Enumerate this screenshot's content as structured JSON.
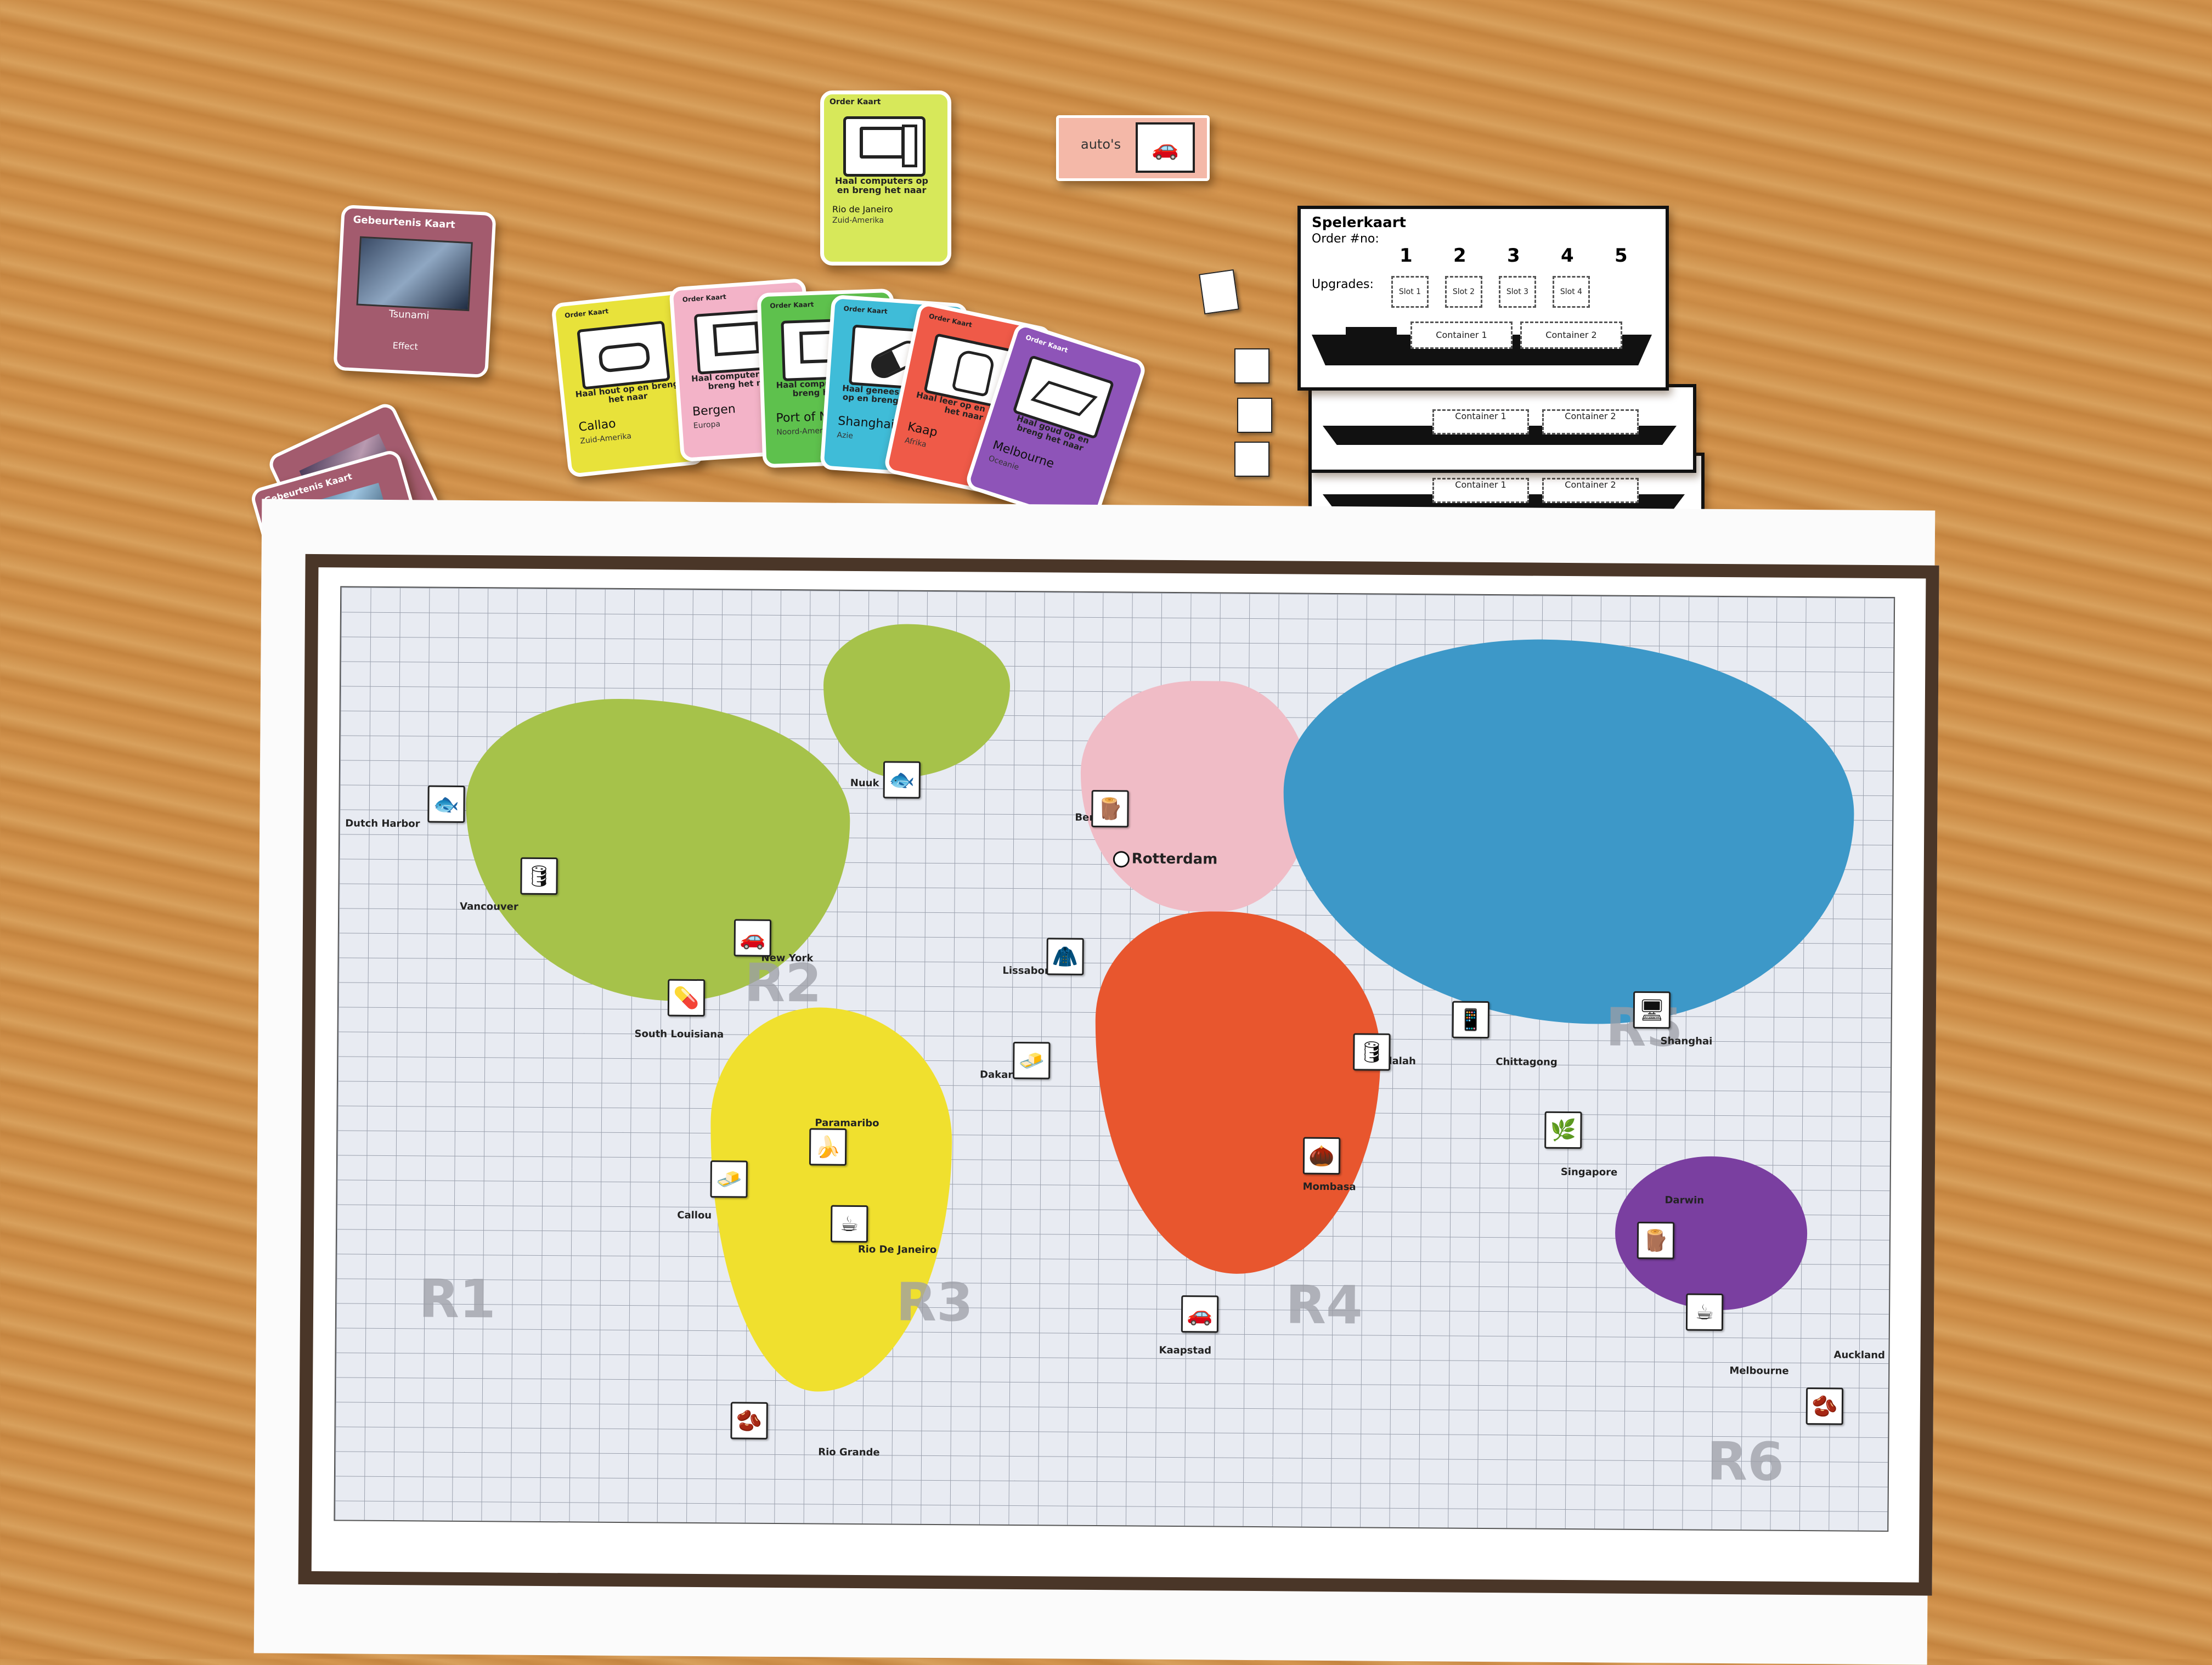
{
  "event_deck": {
    "header": "Gebeurtenis Kaart",
    "title": "Tsunami",
    "effect_label": "Effect"
  },
  "order_deck_top": {
    "header": "Order Kaart",
    "text": "Haal computers op en breng het naar",
    "place": "Rio de Janeiro",
    "region": "Zuid-Amerika",
    "icon": "computer-icon",
    "color": "#d7e85a"
  },
  "upgrade_card": {
    "label": "auto's",
    "icon": "car-icon",
    "color": "#f4b8a8"
  },
  "order_cards": [
    {
      "header": "Order Kaart",
      "text": "Haal hout op en breng het naar",
      "place": "Callao",
      "region": "Zuid-Amerika",
      "icon": "log-icon",
      "color": "#e8e23a"
    },
    {
      "header": "Order Kaart",
      "text": "Haal computers op en breng het naar",
      "place": "Bergen",
      "region": "Europa",
      "icon": "computer-icon",
      "color": "#f3b3c8"
    },
    {
      "header": "Order Kaart",
      "text": "Haal computers op en breng het naar",
      "place": "Port of N",
      "region": "Noord-Amerika",
      "icon": "computer-icon",
      "color": "#5ec14d"
    },
    {
      "header": "Order Kaart",
      "text": "Haal geneesmiddelen op en breng het naar",
      "place": "Shanghai",
      "region": "Azie",
      "icon": "pill-icon",
      "color": "#3fbcd8"
    },
    {
      "header": "Order Kaart",
      "text": "Haal leer op en breng het naar",
      "place": "Kaap",
      "region": "Afrika",
      "icon": "leather-icon",
      "color": "#ef5a48"
    },
    {
      "header": "Order Kaart",
      "text": "Haal goud op en breng het naar",
      "place": "Melbourne",
      "region": "Oceanie",
      "icon": "gold-icon",
      "color": "#8e54b8"
    }
  ],
  "player_card": {
    "title": "Spelerkaart",
    "order_label": "Order #no:",
    "order_numbers": [
      "1",
      "2",
      "3",
      "4",
      "5"
    ],
    "upgrades_label": "Upgrades:",
    "slots": [
      "Slot 1",
      "Slot 2",
      "Slot 3",
      "Slot 4"
    ],
    "containers": [
      "Container 1",
      "Container 2"
    ]
  },
  "map": {
    "regions": [
      "R1",
      "R2",
      "R3",
      "R4",
      "R5",
      "R6"
    ],
    "home_port": "Rotterdam",
    "ports": [
      "Dutch Harbor",
      "Vancouver",
      "New York",
      "South Louisiana",
      "Nuuk",
      "Bergen",
      "Lissabon",
      "Dakar",
      "Paramaribo",
      "Callou",
      "Rio De Janeiro",
      "Rio Grande",
      "Kaapstad",
      "Mombasa",
      "Salalah",
      "Chittagong",
      "Shanghai",
      "Singapore",
      "Darwin",
      "Melbourne",
      "Auckland"
    ],
    "colors": {
      "north_america": "#a6c24a",
      "south_america": "#f0e02e",
      "europe": "#f0bcc6",
      "africa": "#e8562e",
      "asia": "#3d98c8",
      "oceania": "#7a3fa0"
    }
  }
}
